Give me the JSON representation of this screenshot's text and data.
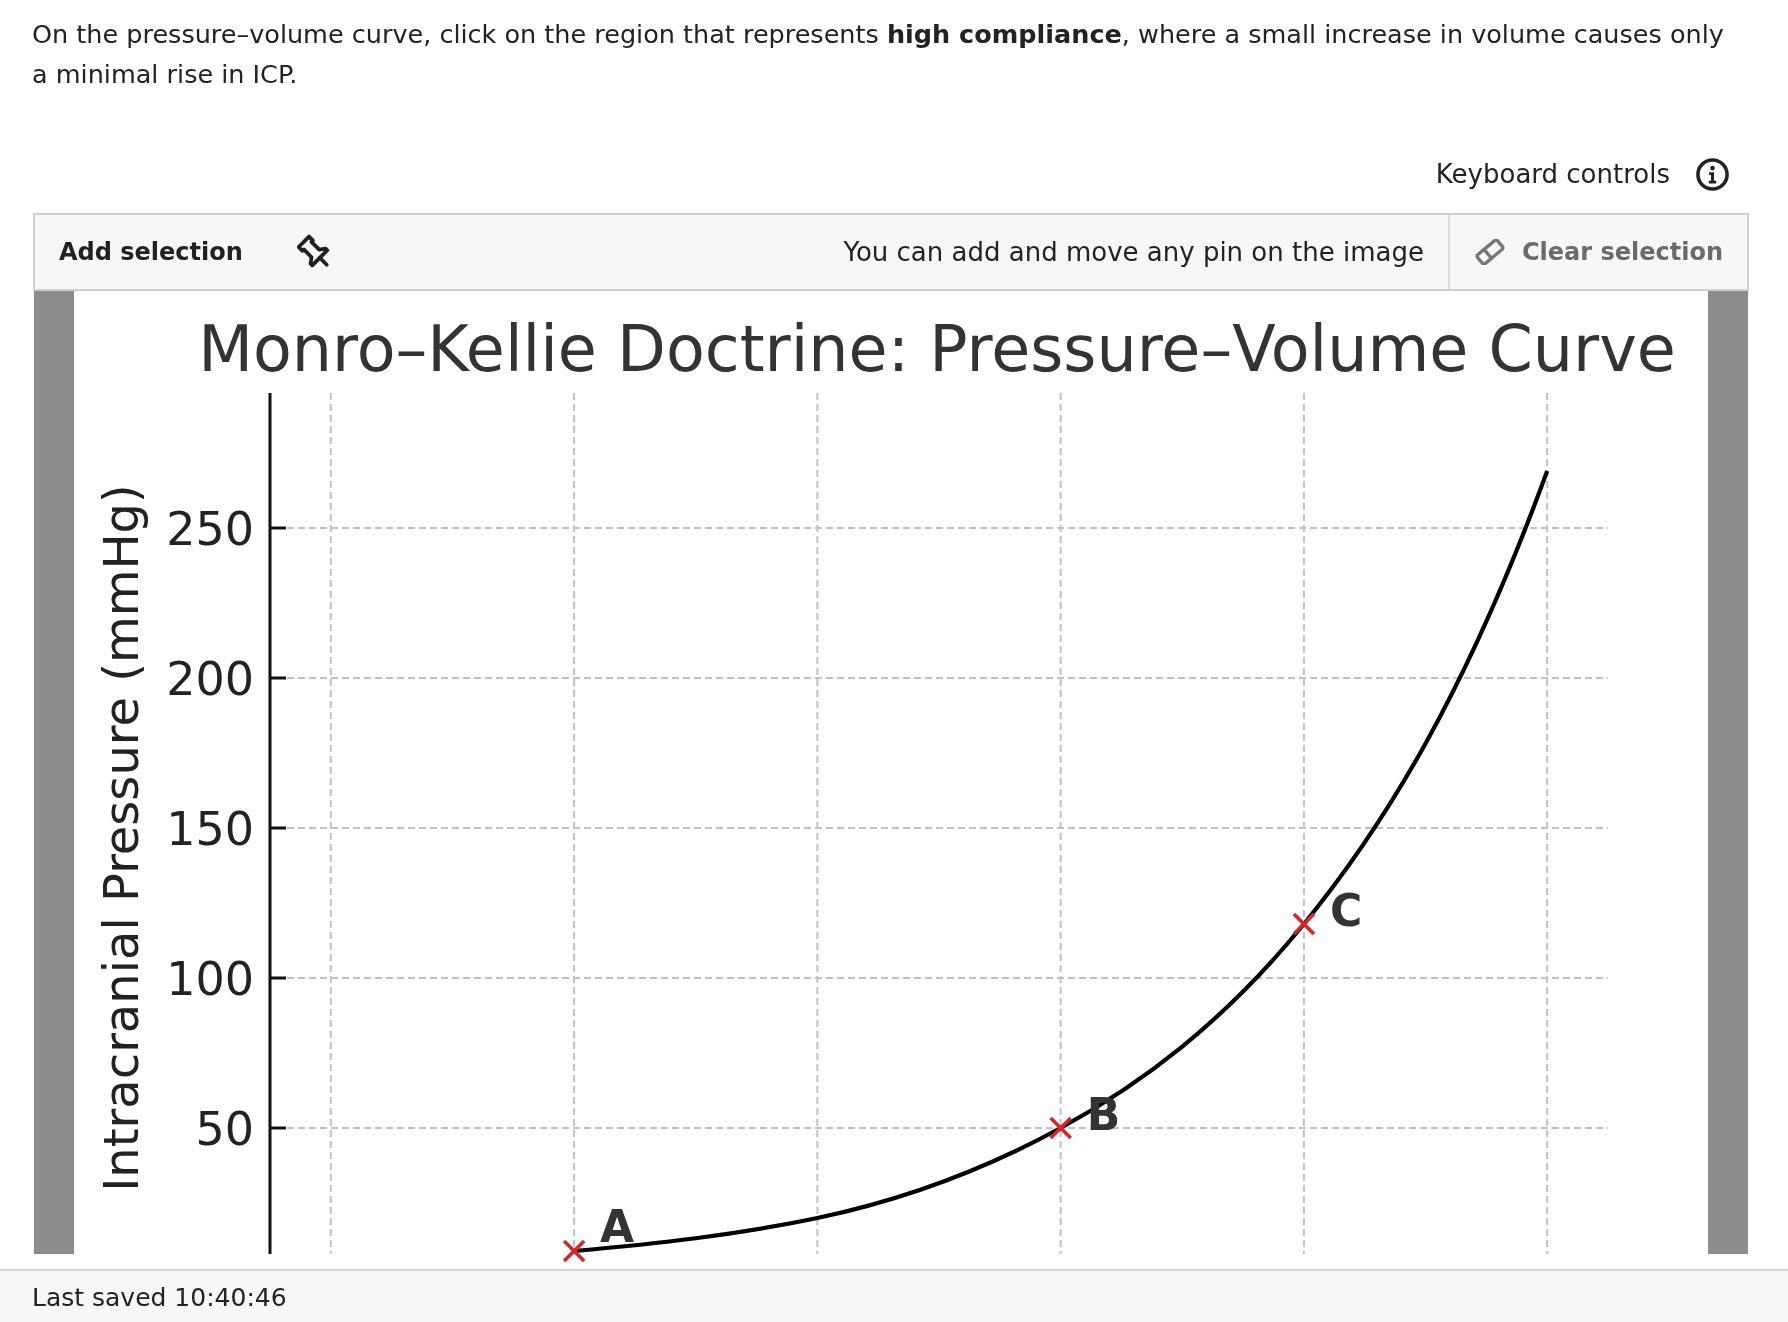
{
  "question": {
    "text": "On the pressure–volume curve, click on the region that represents **high compliance**, where a small increase in volume causes only a minimal rise in ICP."
  },
  "keyboard_controls": {
    "label": "Keyboard controls"
  },
  "toolbar": {
    "add_selection": "Add selection",
    "hint": "You can add and move any pin on the image",
    "clear_selection": "Clear selection"
  },
  "image": {
    "chart_data": [
      {
        "type": "line",
        "title": "Monro–Kellie Doctrine: Pressure–Volume Curve",
        "ylabel": "Intracranial Pressure (mmHg)",
        "categories": [
          null,
          null,
          null,
          null,
          null
        ],
        "yticks": [
          50,
          100,
          150,
          200,
          250
        ],
        "ylim": [
          8,
          295
        ],
        "tick_labels": "y",
        "grid": true,
        "series": [
          {
            "color": "#000000",
            "values": [
              9,
              20,
              50,
              118,
              269
            ]
          },
          {
            "type": "scatter",
            "marker": "cross",
            "color": "#d62728",
            "values": [
              9,
              null,
              50,
              118,
              null
            ]
          }
        ],
        "annotations": [
          "A",
          "B",
          "C"
        ]
      }
    ]
  },
  "footer": {
    "last_saved": "Last saved 10:40:46"
  }
}
